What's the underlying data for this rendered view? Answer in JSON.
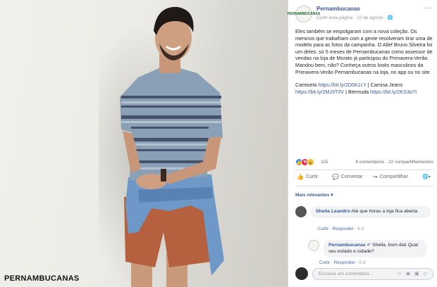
{
  "photo": {
    "watermark": "PERNAMBUCANAS"
  },
  "post": {
    "page_name": "Pernambucanas",
    "meta": "Curtir esta página · 22 de agosto · ",
    "paragraph1": "Eles também se empolgaram com a nova coleção. Os meninos que trabalham com a gente resolveram tirar uma de modelo para as fotos da campanha. O Allef Bruno Silveira foi um deles: só 5 meses de Pernambucanas como assessor de vendas na loja de Morato já participou do Primavera-Verão. Mandou bem, não? Conheça outros looks masculinos da Primavera-Verão Pernambucanas na loja, no app ou no site.",
    "links_prefix1": "Camiseta ",
    "link1": "https://bit.ly/2D0K1LY",
    "links_mid1": " | Camisa Jeans ",
    "link2": "https://bit.ly/2MJ3T0V",
    "links_mid2": " | Bermuda ",
    "link3": "https://bit.ly/2KS3o7I"
  },
  "reactions": {
    "count": "115",
    "meta": "9 comentários · 22 compartilhamentos"
  },
  "actions": {
    "like": "Curtir",
    "comment": "Comentar",
    "share": "Compartilhar"
  },
  "comments_filter": "Mais relevantes ▾",
  "comments": [
    {
      "author": "Sheila Leandro",
      "text": "Até que horas a loja fica aberta",
      "like": "Curtir",
      "reply": "Responder",
      "time": "6 d"
    },
    {
      "author": "Pernambucanas",
      "text": "Sheila, bom dia! Qual seu estado e cidade?",
      "like": "Curtir",
      "reply": "Responder",
      "time": "5 d"
    }
  ],
  "composer": {
    "placeholder": "Escreva um comentário..."
  }
}
